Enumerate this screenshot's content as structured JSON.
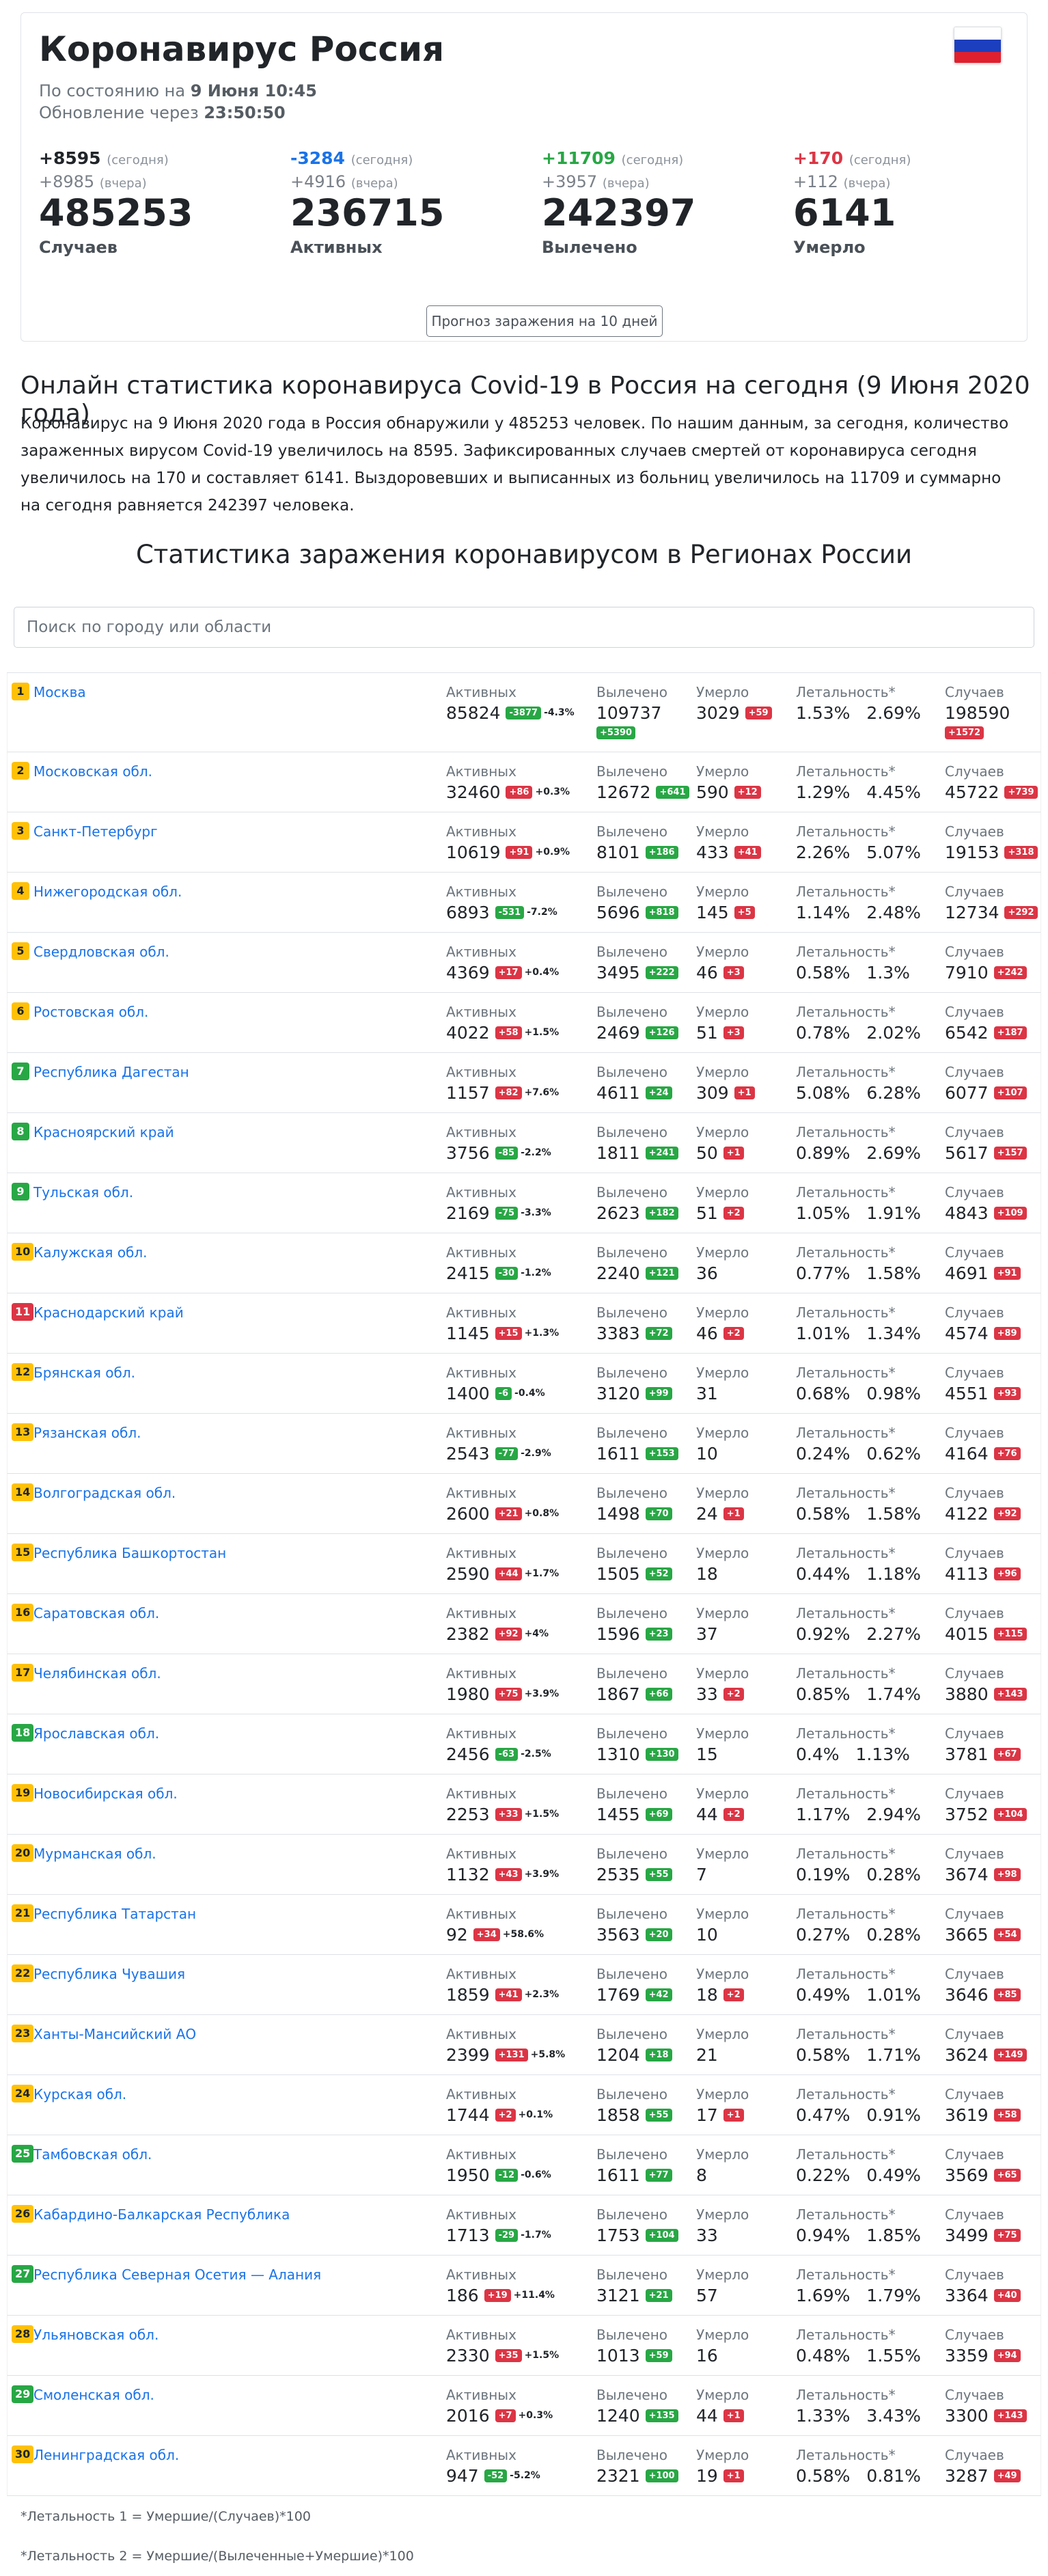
{
  "header": {
    "title": "Коронавирус Россия",
    "status_prefix": "По состоянию на",
    "status_date": "9 Июня 10:45",
    "update_prefix": "Обновление через",
    "update_time": "23:50:50"
  },
  "flag_colors": [
    "#ffffff",
    "#1c3fbf",
    "#e0202e"
  ],
  "summary": [
    {
      "delta": "+8595",
      "delta_note": "(сегодня)",
      "prev": "+8985",
      "prev_note": "(вчера)",
      "value": "485253",
      "label": "Случаев",
      "color": "dark"
    },
    {
      "delta": "-3284",
      "delta_note": "(сегодня)",
      "prev": "+4916",
      "prev_note": "(вчера)",
      "value": "236715",
      "label": "Активных",
      "color": "blue"
    },
    {
      "delta": "+11709",
      "delta_note": "(сегодня)",
      "prev": "+3957",
      "prev_note": "(вчера)",
      "value": "242397",
      "label": "Вылечено",
      "color": "green"
    },
    {
      "delta": "+170",
      "delta_note": "(сегодня)",
      "prev": "+112",
      "prev_note": "(вчера)",
      "value": "6141",
      "label": "Умерло",
      "color": "red"
    }
  ],
  "forecast_button": "Прогноз заражения на 10 дней",
  "article": {
    "heading": "Онлайн статистика коронавируса Covid-19 в Россия на сегодня (9 Июня 2020 года)",
    "text": "Коронавирус на 9 Июня 2020 года в Россия обнаружили у 485253 человек. По нашим данным, за сегодня, количество зараженных вирусом Covid-19 увеличилось на 8595. Зафиксированных случаев смертей от коронавируса сегодня увеличилось на 170 и составляет 6141. Выздоровевших и выписанных из больниц увеличилось на 11709 и суммарно на сегодня равняется 242397 человека."
  },
  "regions_heading": "Статистика заражения коронавирусом в Регионах России",
  "search": {
    "placeholder": "Поиск по городу или области"
  },
  "labels": {
    "active": "Активных",
    "recovered": "Вылечено",
    "died": "Умерло",
    "lethality": "Летальность*",
    "cases": "Случаев"
  },
  "regions": [
    {
      "rank": "1",
      "rank_color": "y",
      "name": "Москва",
      "active": "85824",
      "active_badge": "-3877",
      "active_badge_color": "g",
      "active_pct": "-4.3%",
      "recovered": "109737",
      "recovered_badge": "+5390",
      "died": "3029",
      "died_badge": "+59",
      "l1": "1.53%",
      "l2": "2.69%",
      "cases": "198590",
      "cases_badge": "+1572"
    },
    {
      "rank": "2",
      "rank_color": "y",
      "name": "Московская обл.",
      "active": "32460",
      "active_badge": "+86",
      "active_badge_color": "r",
      "active_pct": "+0.3%",
      "recovered": "12672",
      "recovered_badge": "+641",
      "died": "590",
      "died_badge": "+12",
      "l1": "1.29%",
      "l2": "4.45%",
      "cases": "45722",
      "cases_badge": "+739"
    },
    {
      "rank": "3",
      "rank_color": "y",
      "name": "Санкт-Петербург",
      "active": "10619",
      "active_badge": "+91",
      "active_badge_color": "r",
      "active_pct": "+0.9%",
      "recovered": "8101",
      "recovered_badge": "+186",
      "died": "433",
      "died_badge": "+41",
      "l1": "2.26%",
      "l2": "5.07%",
      "cases": "19153",
      "cases_badge": "+318"
    },
    {
      "rank": "4",
      "rank_color": "y",
      "name": "Нижегородская обл.",
      "active": "6893",
      "active_badge": "-531",
      "active_badge_color": "g",
      "active_pct": "-7.2%",
      "recovered": "5696",
      "recovered_badge": "+818",
      "died": "145",
      "died_badge": "+5",
      "l1": "1.14%",
      "l2": "2.48%",
      "cases": "12734",
      "cases_badge": "+292"
    },
    {
      "rank": "5",
      "rank_color": "y",
      "name": "Свердловская обл.",
      "active": "4369",
      "active_badge": "+17",
      "active_badge_color": "r",
      "active_pct": "+0.4%",
      "recovered": "3495",
      "recovered_badge": "+222",
      "died": "46",
      "died_badge": "+3",
      "l1": "0.58%",
      "l2": "1.3%",
      "cases": "7910",
      "cases_badge": "+242"
    },
    {
      "rank": "6",
      "rank_color": "y",
      "name": "Ростовская обл.",
      "active": "4022",
      "active_badge": "+58",
      "active_badge_color": "r",
      "active_pct": "+1.5%",
      "recovered": "2469",
      "recovered_badge": "+126",
      "died": "51",
      "died_badge": "+3",
      "l1": "0.78%",
      "l2": "2.02%",
      "cases": "6542",
      "cases_badge": "+187"
    },
    {
      "rank": "7",
      "rank_color": "g",
      "name": "Республика Дагестан",
      "active": "1157",
      "active_badge": "+82",
      "active_badge_color": "r",
      "active_pct": "+7.6%",
      "recovered": "4611",
      "recovered_badge": "+24",
      "died": "309",
      "died_badge": "+1",
      "l1": "5.08%",
      "l2": "6.28%",
      "cases": "6077",
      "cases_badge": "+107"
    },
    {
      "rank": "8",
      "rank_color": "g",
      "name": "Красноярский край",
      "active": "3756",
      "active_badge": "-85",
      "active_badge_color": "g",
      "active_pct": "-2.2%",
      "recovered": "1811",
      "recovered_badge": "+241",
      "died": "50",
      "died_badge": "+1",
      "l1": "0.89%",
      "l2": "2.69%",
      "cases": "5617",
      "cases_badge": "+157"
    },
    {
      "rank": "9",
      "rank_color": "g",
      "name": "Тульская обл.",
      "active": "2169",
      "active_badge": "-75",
      "active_badge_color": "g",
      "active_pct": "-3.3%",
      "recovered": "2623",
      "recovered_badge": "+182",
      "died": "51",
      "died_badge": "+2",
      "l1": "1.05%",
      "l2": "1.91%",
      "cases": "4843",
      "cases_badge": "+109"
    },
    {
      "rank": "10",
      "rank_color": "y",
      "name": "Калужская обл.",
      "active": "2415",
      "active_badge": "-30",
      "active_badge_color": "g",
      "active_pct": "-1.2%",
      "recovered": "2240",
      "recovered_badge": "+121",
      "died": "36",
      "died_badge": "",
      "l1": "0.77%",
      "l2": "1.58%",
      "cases": "4691",
      "cases_badge": "+91"
    },
    {
      "rank": "11",
      "rank_color": "r",
      "name": "Краснодарский край",
      "active": "1145",
      "active_badge": "+15",
      "active_badge_color": "r",
      "active_pct": "+1.3%",
      "recovered": "3383",
      "recovered_badge": "+72",
      "died": "46",
      "died_badge": "+2",
      "l1": "1.01%",
      "l2": "1.34%",
      "cases": "4574",
      "cases_badge": "+89"
    },
    {
      "rank": "12",
      "rank_color": "y",
      "name": "Брянская обл.",
      "active": "1400",
      "active_badge": "-6",
      "active_badge_color": "g",
      "active_pct": "-0.4%",
      "recovered": "3120",
      "recovered_badge": "+99",
      "died": "31",
      "died_badge": "",
      "l1": "0.68%",
      "l2": "0.98%",
      "cases": "4551",
      "cases_badge": "+93"
    },
    {
      "rank": "13",
      "rank_color": "y",
      "name": "Рязанская обл.",
      "active": "2543",
      "active_badge": "-77",
      "active_badge_color": "g",
      "active_pct": "-2.9%",
      "recovered": "1611",
      "recovered_badge": "+153",
      "died": "10",
      "died_badge": "",
      "l1": "0.24%",
      "l2": "0.62%",
      "cases": "4164",
      "cases_badge": "+76"
    },
    {
      "rank": "14",
      "rank_color": "y",
      "name": "Волгоградская обл.",
      "active": "2600",
      "active_badge": "+21",
      "active_badge_color": "r",
      "active_pct": "+0.8%",
      "recovered": "1498",
      "recovered_badge": "+70",
      "died": "24",
      "died_badge": "+1",
      "l1": "0.58%",
      "l2": "1.58%",
      "cases": "4122",
      "cases_badge": "+92"
    },
    {
      "rank": "15",
      "rank_color": "y",
      "name": "Республика Башкортостан",
      "active": "2590",
      "active_badge": "+44",
      "active_badge_color": "r",
      "active_pct": "+1.7%",
      "recovered": "1505",
      "recovered_badge": "+52",
      "died": "18",
      "died_badge": "",
      "l1": "0.44%",
      "l2": "1.18%",
      "cases": "4113",
      "cases_badge": "+96"
    },
    {
      "rank": "16",
      "rank_color": "y",
      "name": "Саратовская обл.",
      "active": "2382",
      "active_badge": "+92",
      "active_badge_color": "r",
      "active_pct": "+4%",
      "recovered": "1596",
      "recovered_badge": "+23",
      "died": "37",
      "died_badge": "",
      "l1": "0.92%",
      "l2": "2.27%",
      "cases": "4015",
      "cases_badge": "+115"
    },
    {
      "rank": "17",
      "rank_color": "y",
      "name": "Челябинская обл.",
      "active": "1980",
      "active_badge": "+75",
      "active_badge_color": "r",
      "active_pct": "+3.9%",
      "recovered": "1867",
      "recovered_badge": "+66",
      "died": "33",
      "died_badge": "+2",
      "l1": "0.85%",
      "l2": "1.74%",
      "cases": "3880",
      "cases_badge": "+143"
    },
    {
      "rank": "18",
      "rank_color": "g",
      "name": "Ярославская обл.",
      "active": "2456",
      "active_badge": "-63",
      "active_badge_color": "g",
      "active_pct": "-2.5%",
      "recovered": "1310",
      "recovered_badge": "+130",
      "died": "15",
      "died_badge": "",
      "l1": "0.4%",
      "l2": "1.13%",
      "cases": "3781",
      "cases_badge": "+67"
    },
    {
      "rank": "19",
      "rank_color": "y",
      "name": "Новосибирская обл.",
      "active": "2253",
      "active_badge": "+33",
      "active_badge_color": "r",
      "active_pct": "+1.5%",
      "recovered": "1455",
      "recovered_badge": "+69",
      "died": "44",
      "died_badge": "+2",
      "l1": "1.17%",
      "l2": "2.94%",
      "cases": "3752",
      "cases_badge": "+104"
    },
    {
      "rank": "20",
      "rank_color": "y",
      "name": "Мурманская обл.",
      "active": "1132",
      "active_badge": "+43",
      "active_badge_color": "r",
      "active_pct": "+3.9%",
      "recovered": "2535",
      "recovered_badge": "+55",
      "died": "7",
      "died_badge": "",
      "l1": "0.19%",
      "l2": "0.28%",
      "cases": "3674",
      "cases_badge": "+98"
    },
    {
      "rank": "21",
      "rank_color": "y",
      "name": "Республика Татарстан",
      "active": "92",
      "active_badge": "+34",
      "active_badge_color": "r",
      "active_pct": "+58.6%",
      "recovered": "3563",
      "recovered_badge": "+20",
      "died": "10",
      "died_badge": "",
      "l1": "0.27%",
      "l2": "0.28%",
      "cases": "3665",
      "cases_badge": "+54"
    },
    {
      "rank": "22",
      "rank_color": "y",
      "name": "Республика Чувашия",
      "active": "1859",
      "active_badge": "+41",
      "active_badge_color": "r",
      "active_pct": "+2.3%",
      "recovered": "1769",
      "recovered_badge": "+42",
      "died": "18",
      "died_badge": "+2",
      "l1": "0.49%",
      "l2": "1.01%",
      "cases": "3646",
      "cases_badge": "+85"
    },
    {
      "rank": "23",
      "rank_color": "y",
      "name": "Ханты-Мансийский АО",
      "active": "2399",
      "active_badge": "+131",
      "active_badge_color": "r",
      "active_pct": "+5.8%",
      "recovered": "1204",
      "recovered_badge": "+18",
      "died": "21",
      "died_badge": "",
      "l1": "0.58%",
      "l2": "1.71%",
      "cases": "3624",
      "cases_badge": "+149"
    },
    {
      "rank": "24",
      "rank_color": "y",
      "name": "Курская обл.",
      "active": "1744",
      "active_badge": "+2",
      "active_badge_color": "r",
      "active_pct": "+0.1%",
      "recovered": "1858",
      "recovered_badge": "+55",
      "died": "17",
      "died_badge": "+1",
      "l1": "0.47%",
      "l2": "0.91%",
      "cases": "3619",
      "cases_badge": "+58"
    },
    {
      "rank": "25",
      "rank_color": "g",
      "name": "Тамбовская обл.",
      "active": "1950",
      "active_badge": "-12",
      "active_badge_color": "g",
      "active_pct": "-0.6%",
      "recovered": "1611",
      "recovered_badge": "+77",
      "died": "8",
      "died_badge": "",
      "l1": "0.22%",
      "l2": "0.49%",
      "cases": "3569",
      "cases_badge": "+65"
    },
    {
      "rank": "26",
      "rank_color": "y",
      "name": "Кабардино-Балкарская Республика",
      "active": "1713",
      "active_badge": "-29",
      "active_badge_color": "g",
      "active_pct": "-1.7%",
      "recovered": "1753",
      "recovered_badge": "+104",
      "died": "33",
      "died_badge": "",
      "l1": "0.94%",
      "l2": "1.85%",
      "cases": "3499",
      "cases_badge": "+75"
    },
    {
      "rank": "27",
      "rank_color": "g",
      "name": "Республика Северная Осетия — Алания",
      "active": "186",
      "active_badge": "+19",
      "active_badge_color": "r",
      "active_pct": "+11.4%",
      "recovered": "3121",
      "recovered_badge": "+21",
      "died": "57",
      "died_badge": "",
      "l1": "1.69%",
      "l2": "1.79%",
      "cases": "3364",
      "cases_badge": "+40"
    },
    {
      "rank": "28",
      "rank_color": "y",
      "name": "Ульяновская обл.",
      "active": "2330",
      "active_badge": "+35",
      "active_badge_color": "r",
      "active_pct": "+1.5%",
      "recovered": "1013",
      "recovered_badge": "+59",
      "died": "16",
      "died_badge": "",
      "l1": "0.48%",
      "l2": "1.55%",
      "cases": "3359",
      "cases_badge": "+94"
    },
    {
      "rank": "29",
      "rank_color": "g",
      "name": "Смоленская обл.",
      "active": "2016",
      "active_badge": "+7",
      "active_badge_color": "r",
      "active_pct": "+0.3%",
      "recovered": "1240",
      "recovered_badge": "+135",
      "died": "44",
      "died_badge": "+1",
      "l1": "1.33%",
      "l2": "3.43%",
      "cases": "3300",
      "cases_badge": "+143"
    },
    {
      "rank": "30",
      "rank_color": "y",
      "name": "Ленинградская обл.",
      "active": "947",
      "active_badge": "-52",
      "active_badge_color": "g",
      "active_pct": "-5.2%",
      "recovered": "2321",
      "recovered_badge": "+100",
      "died": "19",
      "died_badge": "+1",
      "l1": "0.58%",
      "l2": "0.81%",
      "cases": "3287",
      "cases_badge": "+49"
    }
  ],
  "footnotes": [
    "*Летальность 1 = Умершие/(Случаев)*100",
    "*Летальность 2 = Умершие/(Вылеченные+Умершие)*100"
  ]
}
